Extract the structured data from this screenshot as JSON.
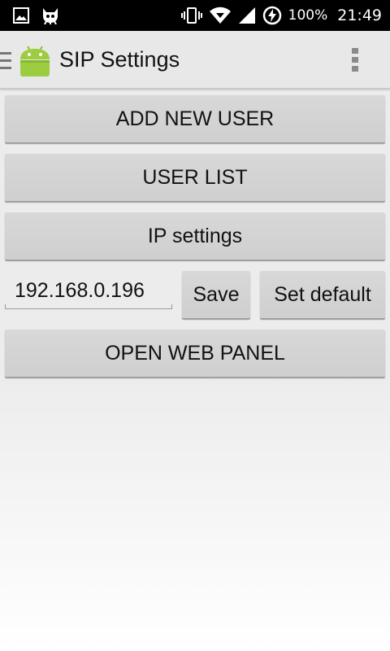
{
  "status_bar": {
    "battery": "100%",
    "time": "21:49"
  },
  "action_bar": {
    "title": "SIP Settings"
  },
  "buttons": {
    "add_new_user": "ADD NEW USER",
    "user_list": "USER LIST",
    "ip_settings": "IP settings",
    "save": "Save",
    "set_default": "Set default",
    "open_web_panel": "OPEN WEB PANEL"
  },
  "ip_field": {
    "value": "192.168.0.196"
  },
  "icons": {
    "status_left": [
      "image-icon",
      "cat-icon"
    ],
    "status_right": [
      "vibrate-icon",
      "wifi-icon",
      "signal-icon",
      "charging-battery-icon"
    ],
    "action_bar": [
      "drawer-menu-icon",
      "android-app-icon",
      "overflow-menu-icon"
    ]
  },
  "colors": {
    "status_bar": "#000000",
    "action_bar": "#e8e8e8",
    "button": "#d4d4d4",
    "text": "#111111"
  }
}
